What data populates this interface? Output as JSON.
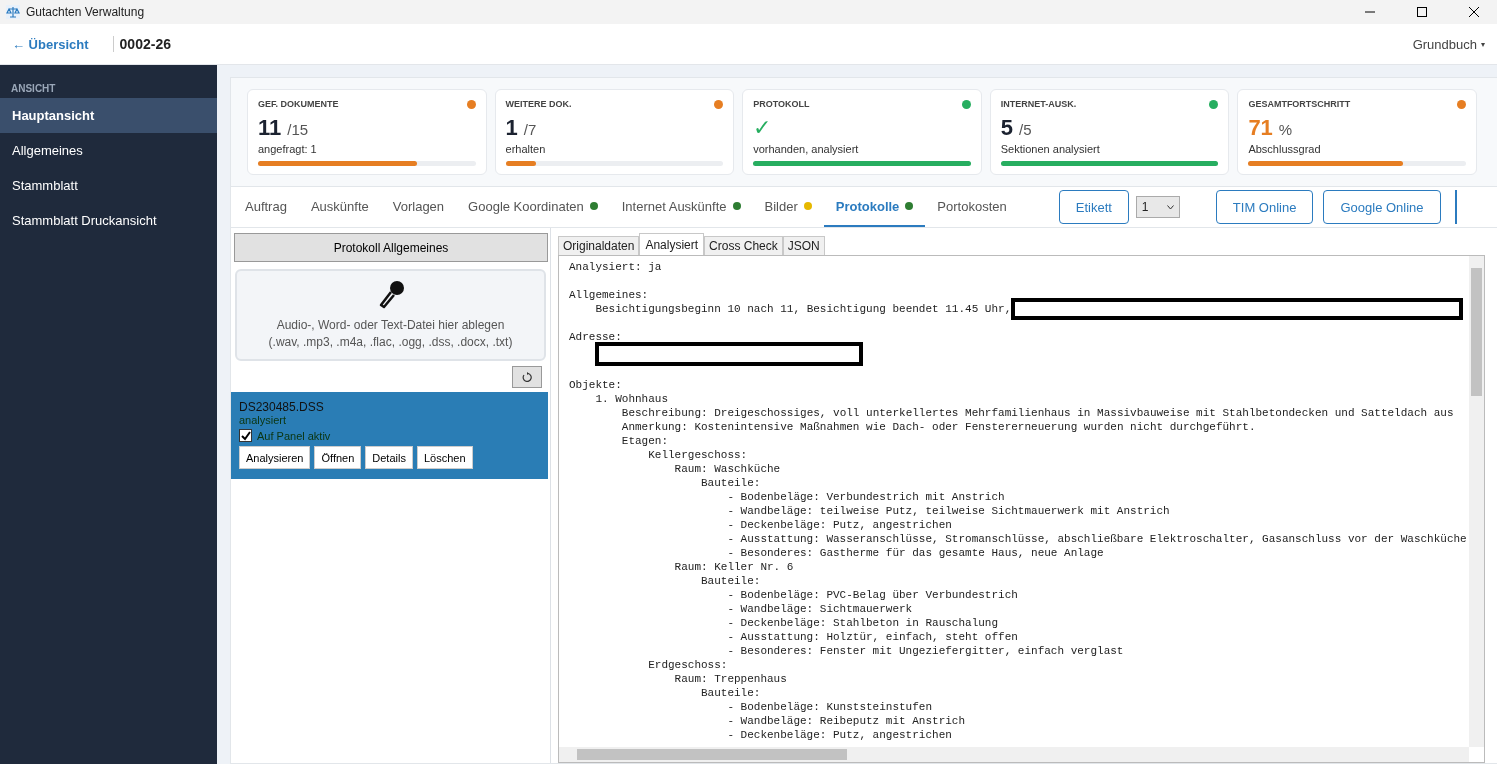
{
  "window": {
    "title": "Gutachten Verwaltung"
  },
  "header": {
    "back_link": "← Übersicht",
    "case_number": "0002-26",
    "menu": "Grundbuch",
    "menu_caret": "▾"
  },
  "sidebar": {
    "section": "ANSICHT",
    "items": [
      {
        "label": "Hauptansicht",
        "selected": true
      },
      {
        "label": "Allgemeines",
        "selected": false
      },
      {
        "label": "Stammblatt",
        "selected": false
      },
      {
        "label": "Stammblatt Druckansicht",
        "selected": false
      }
    ]
  },
  "stats": [
    {
      "label": "GEF. DOKUMENTE",
      "kind": "count",
      "value": "11",
      "total": "/15",
      "sub": "angefragt: 1",
      "level": 0.73,
      "color": "#e67e22"
    },
    {
      "label": "WEITERE DOK.",
      "kind": "count",
      "value": "1",
      "total": "/7",
      "sub": "erhalten",
      "level": 0.14,
      "color": "#e67e22"
    },
    {
      "label": "PROTOKOLL",
      "kind": "check",
      "value": "✓",
      "sub": "vorhanden, analysiert",
      "level": 1,
      "color": "#27ae60"
    },
    {
      "label": "INTERNET-AUSK.",
      "kind": "count",
      "value": "5",
      "total": "/5",
      "sub": "Sektionen analysiert",
      "level": 1,
      "color": "#27ae60"
    },
    {
      "label": "GESAMTFORTSCHRITT",
      "kind": "percent",
      "value": "71",
      "total": "%",
      "sub": "Abschlussgrad",
      "level": 0.71,
      "color": "#e67e22"
    }
  ],
  "tabs": [
    {
      "label": "Auftrag",
      "selected": false
    },
    {
      "label": "Auskünfte",
      "selected": false
    },
    {
      "label": "Vorlagen",
      "selected": false
    },
    {
      "label": "Google Koordinaten",
      "selected": false,
      "color": "#2e7d32"
    },
    {
      "label": "Internet Auskünfte",
      "selected": false,
      "color": "#2e7d32"
    },
    {
      "label": "Bilder",
      "selected": false,
      "color": "#e6b800"
    },
    {
      "label": "Protokolle",
      "selected": true,
      "color": "#2e7d32"
    },
    {
      "label": "Portokosten",
      "selected": false
    }
  ],
  "actions": {
    "label_button": "Etikett",
    "copies": "1",
    "links": [
      "TIM Online",
      "Google Online"
    ]
  },
  "upload": {
    "button": "Protokoll Allgemeines",
    "drop_text": "Audio-, Word- oder Text-Datei hier ablegen",
    "formats": "(.wav, .mp3, .m4a, .flac, .ogg, .dss, .docx, .txt)"
  },
  "files": [
    {
      "name": "DS230485.DSS",
      "status": "analysiert",
      "selected": true,
      "checked": true,
      "check_label": "Auf Panel aktiv",
      "buttons": [
        "Analysieren",
        "Öffnen",
        "Details",
        "Löschen"
      ]
    }
  ],
  "result_tabs": [
    {
      "label": "Originaldaten",
      "selected": false
    },
    {
      "label": "Analysiert",
      "selected": true
    },
    {
      "label": "Cross Check",
      "selected": false
    },
    {
      "label": "JSON",
      "selected": false
    }
  ],
  "document": [
    {
      "text": "Analysiert: ja",
      "redacted": false
    },
    {
      "text": "Allgemeines:",
      "redacted": false,
      "children": [
        {
          "text": "Besichtigungsbeginn 10 nach 11, Besichtigung beendet 11.45 Uhr,",
          "redacted": true
        }
      ]
    },
    {
      "text": "Adresse:",
      "redacted": false,
      "children": [
        {
          "redacted": true
        }
      ]
    },
    {
      "text": "Objekte:",
      "redacted": false,
      "children": [
        {
          "text": "1. Wohnhaus",
          "redacted": false,
          "children": [
            {
              "text": "Beschreibung: Dreigeschossiges, voll unterkellertes Mehrfamilienhaus in Massivbauweise mit Stahlbetondecken und Satteldach aus",
              "redacted": false
            },
            {
              "text": "Anmerkung: Kostenintensive Maßnahmen wie Dach- oder Fenstererneuerung wurden nicht durchgeführt.",
              "redacted": false
            },
            {
              "text": "Etagen:",
              "redacted": false,
              "children": [
                {
                  "text": "Kellergeschoss:",
                  "redacted": false,
                  "children": [
                    {
                      "text": "Raum: Waschküche",
                      "redacted": false,
                      "children": [
                        {
                          "text": "Bauteile:",
                          "redacted": false,
                          "children": [
                            {
                              "text": "- Bodenbeläge: Verbundestrich mit Anstrich",
                              "redacted": false
                            },
                            {
                              "text": "- Wandbeläge: teilweise Putz, teilweise Sichtmauerwerk mit Anstrich",
                              "redacted": false
                            },
                            {
                              "text": "- Deckenbeläge: Putz, angestrichen",
                              "redacted": false
                            },
                            {
                              "text": "- Ausstattung: Wasseranschlüsse, Stromanschlüsse, abschließbare Elektroschalter, Gasanschluss vor der Waschküche",
                              "redacted": false
                            },
                            {
                              "text": "- Besonderes: Gastherme für das gesamte Haus, neue Anlage",
                              "redacted": false
                            }
                          ]
                        }
                      ]
                    },
                    {
                      "text": "Raum: Keller Nr. 6",
                      "redacted": false,
                      "children": [
                        {
                          "text": "Bauteile:",
                          "redacted": false,
                          "children": [
                            {
                              "text": "- Bodenbeläge: PVC-Belag über Verbundestrich",
                              "redacted": false
                            },
                            {
                              "text": "- Wandbeläge: Sichtmauerwerk",
                              "redacted": false
                            },
                            {
                              "text": "- Deckenbeläge: Stahlbeton in Rauschalung",
                              "redacted": false
                            },
                            {
                              "text": "- Ausstattung: Holztür, einfach, steht offen",
                              "redacted": false
                            },
                            {
                              "text": "- Besonderes: Fenster mit Ungeziefergitter, einfach verglast",
                              "redacted": false
                            }
                          ]
                        }
                      ]
                    }
                  ]
                },
                {
                  "text": "Erdgeschoss:",
                  "redacted": false,
                  "children": [
                    {
                      "text": "Raum: Treppenhaus",
                      "redacted": false,
                      "children": [
                        {
                          "text": "Bauteile:",
                          "redacted": false,
                          "children": [
                            {
                              "text": "- Bodenbeläge: Kunststeinstufen",
                              "redacted": false
                            },
                            {
                              "text": "- Wandbeläge: Reibeputz mit Anstrich",
                              "redacted": false
                            },
                            {
                              "text": "- Deckenbeläge: Putz, angestrichen",
                              "redacted": false
                            }
                          ]
                        }
                      ]
                    }
                  ]
                }
              ]
            }
          ]
        }
      ]
    }
  ]
}
